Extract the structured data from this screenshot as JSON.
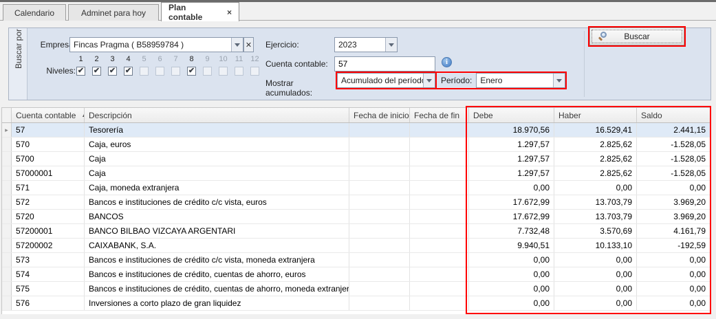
{
  "tabs": [
    {
      "label": "Calendario",
      "active": false
    },
    {
      "label": "Adminet para hoy",
      "active": false
    },
    {
      "label": "Plan contable",
      "active": true
    }
  ],
  "icons": {
    "tab_close": "×",
    "clear": "✕",
    "check": "✔",
    "info": "i",
    "sort_asc": "▲",
    "row_marker": "▸"
  },
  "filter": {
    "side_tab": "Buscar por",
    "empresa_label": "Empresa:",
    "empresa_value": "Fincas Pragma ( B58959784 )",
    "niveles_label": "Niveles:",
    "niveles": [
      {
        "n": "1",
        "checked": true,
        "enabled": true
      },
      {
        "n": "2",
        "checked": true,
        "enabled": true
      },
      {
        "n": "3",
        "checked": true,
        "enabled": true
      },
      {
        "n": "4",
        "checked": true,
        "enabled": true
      },
      {
        "n": "5",
        "checked": false,
        "enabled": false
      },
      {
        "n": "6",
        "checked": false,
        "enabled": false
      },
      {
        "n": "7",
        "checked": false,
        "enabled": false
      },
      {
        "n": "8",
        "checked": true,
        "enabled": true
      },
      {
        "n": "9",
        "checked": false,
        "enabled": false
      },
      {
        "n": "10",
        "checked": false,
        "enabled": false
      },
      {
        "n": "11",
        "checked": false,
        "enabled": false
      },
      {
        "n": "12",
        "checked": false,
        "enabled": false
      }
    ],
    "ejercicio_label": "Ejercicio:",
    "ejercicio_value": "2023",
    "cuenta_label": "Cuenta contable:",
    "cuenta_value": "57",
    "mostrar_label": "Mostrar acumulados:",
    "mostrar_value": "Acumulado del período",
    "periodo_label": "Período:",
    "periodo_value": "Enero",
    "buscar_label": "Buscar"
  },
  "grid": {
    "columns": [
      {
        "key": "cuenta",
        "label": "Cuenta contable",
        "sort": "asc"
      },
      {
        "key": "desc",
        "label": "Descripción"
      },
      {
        "key": "inicio",
        "label": "Fecha de inicio"
      },
      {
        "key": "fin",
        "label": "Fecha de fin"
      },
      {
        "key": "debe",
        "label": "Debe",
        "numeric": true
      },
      {
        "key": "haber",
        "label": "Haber",
        "numeric": true
      },
      {
        "key": "saldo",
        "label": "Saldo",
        "numeric": true
      }
    ],
    "rows": [
      {
        "cuenta": "57",
        "desc": "Tesorería",
        "inicio": "",
        "fin": "",
        "debe": "18.970,56",
        "haber": "16.529,41",
        "saldo": "2.441,15",
        "selected": true
      },
      {
        "cuenta": "570",
        "desc": "Caja, euros",
        "inicio": "",
        "fin": "",
        "debe": "1.297,57",
        "haber": "2.825,62",
        "saldo": "-1.528,05"
      },
      {
        "cuenta": "5700",
        "desc": "Caja",
        "inicio": "",
        "fin": "",
        "debe": "1.297,57",
        "haber": "2.825,62",
        "saldo": "-1.528,05"
      },
      {
        "cuenta": "57000001",
        "desc": "Caja",
        "inicio": "",
        "fin": "",
        "debe": "1.297,57",
        "haber": "2.825,62",
        "saldo": "-1.528,05"
      },
      {
        "cuenta": "571",
        "desc": "Caja, moneda extranjera",
        "inicio": "",
        "fin": "",
        "debe": "0,00",
        "haber": "0,00",
        "saldo": "0,00"
      },
      {
        "cuenta": "572",
        "desc": "Bancos e instituciones de crédito c/c vista, euros",
        "inicio": "",
        "fin": "",
        "debe": "17.672,99",
        "haber": "13.703,79",
        "saldo": "3.969,20"
      },
      {
        "cuenta": "5720",
        "desc": "BANCOS",
        "inicio": "",
        "fin": "",
        "debe": "17.672,99",
        "haber": "13.703,79",
        "saldo": "3.969,20"
      },
      {
        "cuenta": "57200001",
        "desc": "BANCO BILBAO VIZCAYA ARGENTARI",
        "inicio": "",
        "fin": "",
        "debe": "7.732,48",
        "haber": "3.570,69",
        "saldo": "4.161,79"
      },
      {
        "cuenta": "57200002",
        "desc": "CAIXABANK, S.A.",
        "inicio": "",
        "fin": "",
        "debe": "9.940,51",
        "haber": "10.133,10",
        "saldo": "-192,59"
      },
      {
        "cuenta": "573",
        "desc": "Bancos e instituciones de crédito c/c vista, moneda extranjera",
        "inicio": "",
        "fin": "",
        "debe": "0,00",
        "haber": "0,00",
        "saldo": "0,00"
      },
      {
        "cuenta": "574",
        "desc": "Bancos e instituciones de crédito, cuentas de ahorro, euros",
        "inicio": "",
        "fin": "",
        "debe": "0,00",
        "haber": "0,00",
        "saldo": "0,00"
      },
      {
        "cuenta": "575",
        "desc": "Bancos e instituciones de crédito, cuentas de ahorro, moneda extranjera",
        "inicio": "",
        "fin": "",
        "debe": "0,00",
        "haber": "0,00",
        "saldo": "0,00"
      },
      {
        "cuenta": "576",
        "desc": "Inversiones a corto plazo de gran liquidez",
        "inicio": "",
        "fin": "",
        "debe": "0,00",
        "haber": "0,00",
        "saldo": "0,00"
      }
    ]
  },
  "colors": {
    "highlight": "#ff0000",
    "panel_bg": "#dbe3ef",
    "selected_row_bg": "#dfeaf7"
  }
}
